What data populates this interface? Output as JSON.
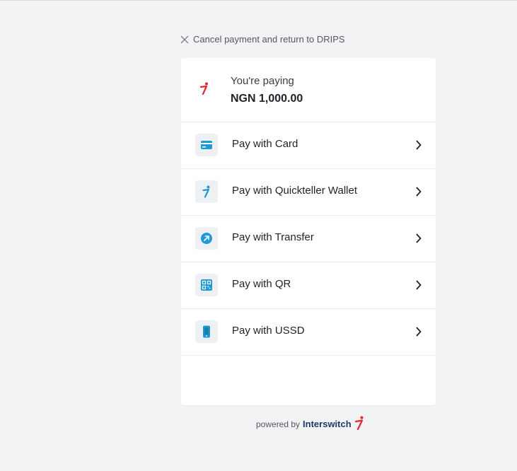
{
  "cancel": {
    "label": "Cancel payment and return to DRIPS",
    "icon": "close-icon"
  },
  "summary": {
    "label": "You're paying",
    "amount": "NGN 1,000.00",
    "logo": "interswitch-logo-icon"
  },
  "methods": [
    {
      "label": "Pay with Card",
      "icon": "card-icon"
    },
    {
      "label": "Pay with Quickteller Wallet",
      "icon": "quickteller-icon"
    },
    {
      "label": "Pay with Transfer",
      "icon": "transfer-icon"
    },
    {
      "label": "Pay with QR",
      "icon": "qr-icon"
    },
    {
      "label": "Pay with USSD",
      "icon": "phone-icon"
    }
  ],
  "footer": {
    "powered_by": "powered by",
    "brand": "Interswitch"
  },
  "colors": {
    "accent_blue": "#1f9ad6",
    "brand_red": "#e0262b",
    "brand_navy": "#1f3b68",
    "background": "#f2f3f5"
  }
}
